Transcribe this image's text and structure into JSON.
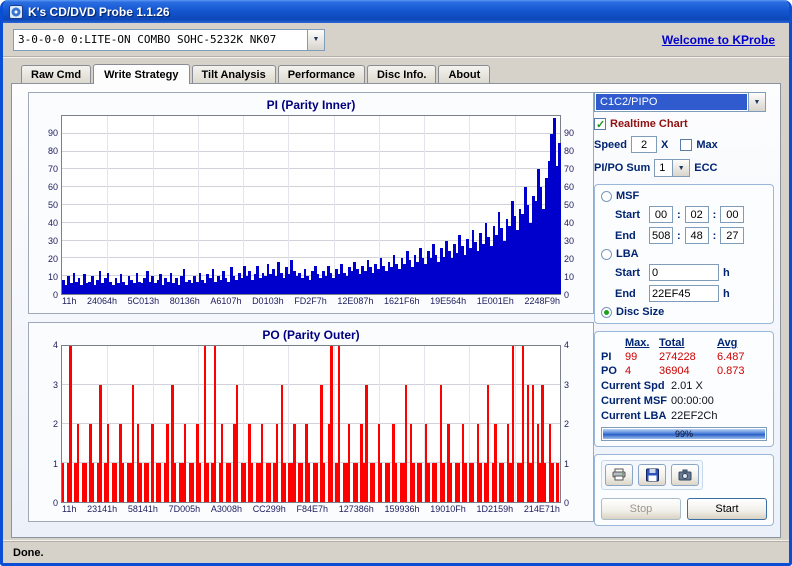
{
  "window": {
    "title": "K's CD/DVD Probe 1.1.26"
  },
  "toolbar": {
    "device": "3-0-0-0 0:LITE-ON COMBO SOHC-5232K NK07",
    "welcome_link": "Welcome to KProbe"
  },
  "tabs": [
    {
      "label": "Raw Cmd"
    },
    {
      "label": "Write Strategy"
    },
    {
      "label": "Tilt Analysis"
    },
    {
      "label": "Performance"
    },
    {
      "label": "Disc Info."
    },
    {
      "label": "About"
    }
  ],
  "icons": {
    "dropdown_arrow": "▼"
  },
  "sidebar": {
    "mode_select": "C1C2/PIPO",
    "realtime_label": "Realtime Chart",
    "speed": {
      "label": "Speed",
      "value": "2",
      "x_label": "X",
      "max_label": "Max"
    },
    "pipo": {
      "label": "PI/PO Sum",
      "value": "1",
      "ecc_label": "ECC"
    },
    "range": {
      "colon": ":",
      "msf_label": "MSF",
      "start_label": "Start",
      "end_label": "End",
      "msf_start": [
        "00",
        "02",
        "00"
      ],
      "msf_end": [
        "508",
        "48",
        "27"
      ],
      "lba_label": "LBA",
      "lba_start": "0",
      "lba_end": "22EF45",
      "unit": "h",
      "disc_label": "Disc Size"
    },
    "stats": {
      "headers": [
        "Max.",
        "Total",
        "Avg"
      ],
      "pi_label": "PI",
      "pi": [
        "99",
        "274228",
        "6.487"
      ],
      "po_label": "PO",
      "po": [
        "4",
        "36904",
        "0.873"
      ],
      "spd_label": "Current Spd",
      "spd": "2.01  X",
      "msf_label": "Current MSF",
      "msf": "00:00:00",
      "lba_label": "Current LBA",
      "lba": "22EF2Ch",
      "progress_pct": 99,
      "progress_label": "99%"
    },
    "actions": {
      "stop": "Stop",
      "start": "Start"
    }
  },
  "status_bar": {
    "text": "Done."
  },
  "chart_data": [
    {
      "type": "bar",
      "title": "PI (Parity Inner)",
      "color": "#0000cc",
      "x_tick_labels": [
        "11h",
        "24064h",
        "5C013h",
        "80136h",
        "A6107h",
        "D0103h",
        "FD2F7h",
        "12E087h",
        "1621F6h",
        "19E564h",
        "1E001Eh",
        "2248F9h"
      ],
      "y_ticks": [
        0,
        10,
        20,
        30,
        40,
        50,
        60,
        70,
        80,
        90
      ],
      "ylim": [
        0,
        100
      ],
      "values": [
        8,
        5,
        10,
        6,
        12,
        7,
        9,
        5,
        11,
        6,
        7,
        10,
        5,
        8,
        13,
        6,
        9,
        12,
        7,
        5,
        9,
        6,
        11,
        7,
        5,
        10,
        8,
        6,
        12,
        7,
        6,
        9,
        13,
        7,
        10,
        6,
        8,
        11,
        5,
        9,
        7,
        12,
        6,
        9,
        5,
        10,
        14,
        7,
        8,
        6,
        10,
        7,
        12,
        8,
        6,
        11,
        9,
        14,
        7,
        10,
        8,
        13,
        9,
        7,
        15,
        10,
        8,
        12,
        9,
        16,
        10,
        13,
        8,
        11,
        16,
        9,
        12,
        10,
        17,
        11,
        14,
        10,
        18,
        12,
        9,
        15,
        11,
        19,
        13,
        10,
        12,
        9,
        14,
        10,
        8,
        13,
        16,
        11,
        9,
        13,
        10,
        16,
        12,
        9,
        14,
        11,
        17,
        12,
        10,
        15,
        13,
        18,
        14,
        11,
        16,
        13,
        19,
        15,
        12,
        17,
        14,
        20,
        16,
        13,
        18,
        15,
        22,
        17,
        14,
        20,
        17,
        24,
        19,
        15,
        22,
        18,
        26,
        20,
        17,
        24,
        20,
        28,
        22,
        18,
        26,
        21,
        30,
        24,
        20,
        28,
        23,
        33,
        27,
        22,
        31,
        26,
        36,
        29,
        24,
        34,
        28,
        40,
        32,
        27,
        38,
        33,
        46,
        37,
        30,
        42,
        38,
        52,
        44,
        36,
        48,
        45,
        60,
        50,
        40,
        55,
        52,
        70,
        60,
        48,
        65,
        75,
        90,
        99,
        72,
        85
      ]
    },
    {
      "type": "bar",
      "title": "PO (Parity Outer)",
      "color": "#ff0000",
      "x_tick_labels": [
        "11h",
        "23141h",
        "58141h",
        "7D005h",
        "A3008h",
        "CC299h",
        "F84E7h",
        "127386h",
        "159936h",
        "19010Fh",
        "1D2159h",
        "214E71h"
      ],
      "y_ticks": [
        0,
        1,
        2,
        3,
        4
      ],
      "ylim": [
        0,
        4
      ],
      "values": [
        1,
        0,
        1,
        4,
        0,
        1,
        2,
        0,
        1,
        1,
        0,
        2,
        1,
        0,
        1,
        3,
        0,
        1,
        2,
        0,
        1,
        1,
        0,
        2,
        1,
        0,
        1,
        1,
        3,
        0,
        2,
        1,
        0,
        1,
        1,
        0,
        2,
        0,
        1,
        1,
        0,
        1,
        2,
        0,
        3,
        1,
        0,
        1,
        1,
        2,
        0,
        1,
        1,
        0,
        2,
        1,
        0,
        4,
        1,
        0,
        1,
        4,
        0,
        1,
        2,
        0,
        1,
        1,
        0,
        2,
        3,
        0,
        1,
        1,
        0,
        2,
        1,
        0,
        1,
        1,
        2,
        0,
        1,
        1,
        0,
        1,
        2,
        0,
        3,
        1,
        0,
        1,
        1,
        2,
        0,
        1,
        1,
        0,
        2,
        1,
        0,
        1,
        1,
        0,
        3,
        1,
        0,
        2,
        4,
        0,
        1,
        4,
        0,
        1,
        1,
        2,
        0,
        1,
        1,
        0,
        2,
        1,
        3,
        0,
        1,
        1,
        0,
        2,
        1,
        0,
        1,
        1,
        0,
        2,
        1,
        0,
        1,
        1,
        3,
        0,
        2,
        1,
        0,
        1,
        1,
        0,
        2,
        1,
        0,
        1,
        1,
        0,
        3,
        1,
        0,
        2,
        1,
        0,
        1,
        1,
        0,
        2,
        1,
        0,
        1,
        1,
        0,
        2,
        1,
        0,
        1,
        3,
        0,
        1,
        2,
        0,
        1,
        1,
        0,
        2,
        1,
        4,
        0,
        1,
        1,
        4,
        0,
        3,
        1,
        3,
        0,
        2,
        1,
        3,
        1,
        0,
        2,
        1,
        0,
        1
      ]
    }
  ]
}
